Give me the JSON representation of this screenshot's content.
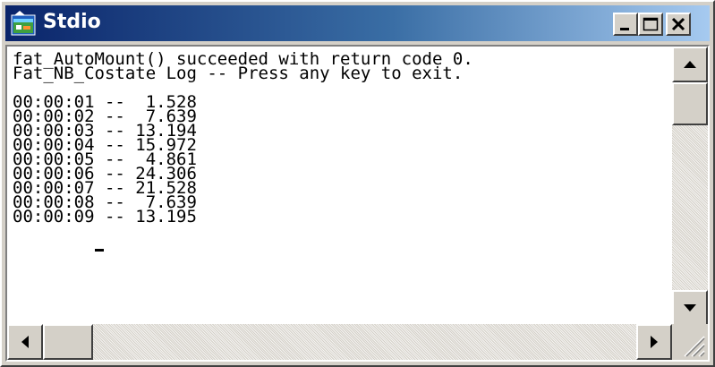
{
  "window": {
    "title": "Stdio",
    "icon": "app-window-icon",
    "controls": {
      "minimize": "minimize-icon",
      "maximize": "maximize-icon",
      "close": "close-icon"
    }
  },
  "console": {
    "lines": [
      "fat_AutoMount() succeeded with return code 0.",
      "Fat_NB_Costate Log -- Press any key to exit.",
      "",
      "00:00:01 --  1.528",
      "00:00:02 --  7.639",
      "00:00:03 -- 13.194",
      "00:00:04 -- 15.972",
      "00:00:05 --  4.861",
      "00:00:06 -- 24.306",
      "00:00:07 -- 21.528",
      "00:00:08 --  7.639",
      "00:00:09 -- 13.195"
    ]
  },
  "colors": {
    "titlebar_start": "#0a246a",
    "titlebar_end": "#a6caf0",
    "chrome": "#d4d0c8",
    "console_bg": "#ffffff",
    "console_text": "#000000"
  }
}
